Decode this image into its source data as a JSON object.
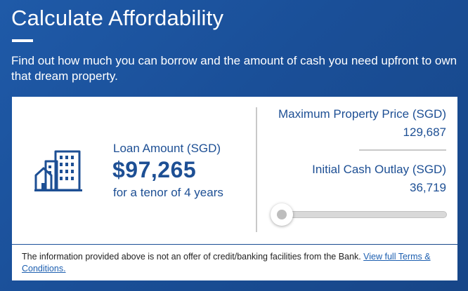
{
  "header": {
    "title": "Calculate Affordability",
    "intro": "Find out how much you can borrow and the amount of cash you need upfront to own that dream property."
  },
  "loan": {
    "label": "Loan Amount (SGD)",
    "amount": "$97,265",
    "tenor": "for a tenor of 4 years"
  },
  "summary": {
    "max_price_label": "Maximum Property Price (SGD)",
    "max_price_value": "129,687",
    "cash_outlay_label": "Initial Cash Outlay (SGD)",
    "cash_outlay_value": "36,719"
  },
  "slider": {
    "value_fraction": 0.0
  },
  "disclaimer": {
    "text": "The information provided above is not an offer of credit/banking facilities from the Bank. ",
    "link_label": "View full Terms & Conditions."
  },
  "colors": {
    "background": "#1a4f98",
    "accent_text": "#1d4f94",
    "link": "#1d5fb0",
    "card": "#ffffff"
  },
  "icons": {
    "loan_icon": "building-icon"
  }
}
